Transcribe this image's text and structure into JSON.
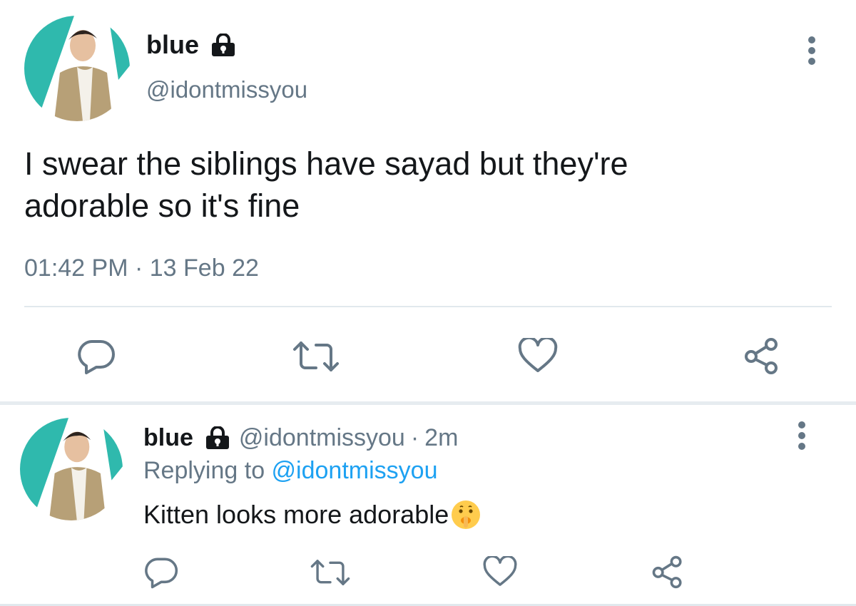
{
  "main_tweet": {
    "display_name": "blue",
    "handle": "@idontmissyou",
    "text_line1": "I swear the siblings have sayad but they're",
    "text_line2": "adorable so it's fine",
    "time": "01:42 PM",
    "separator": "·",
    "date": "13 Feb 22"
  },
  "reply_tweet": {
    "display_name": "blue",
    "handle": "@idontmissyou",
    "separator": "·",
    "age": "2m",
    "replying_prefix": "Replying to ",
    "replying_to": "@idontmissyou",
    "text": "Kitten looks more adorable"
  },
  "icons": {
    "lock": "lock-icon",
    "more": "more-vertical-icon",
    "reply": "reply-icon",
    "retweet": "retweet-icon",
    "like": "heart-icon",
    "share": "share-icon",
    "emoji": "shushing-face-emoji"
  },
  "colors": {
    "text": "#14171a",
    "muted": "#657786",
    "link": "#1da1f2",
    "divider": "#e1e8ed",
    "avatar_teal": "#2fb9ad"
  }
}
